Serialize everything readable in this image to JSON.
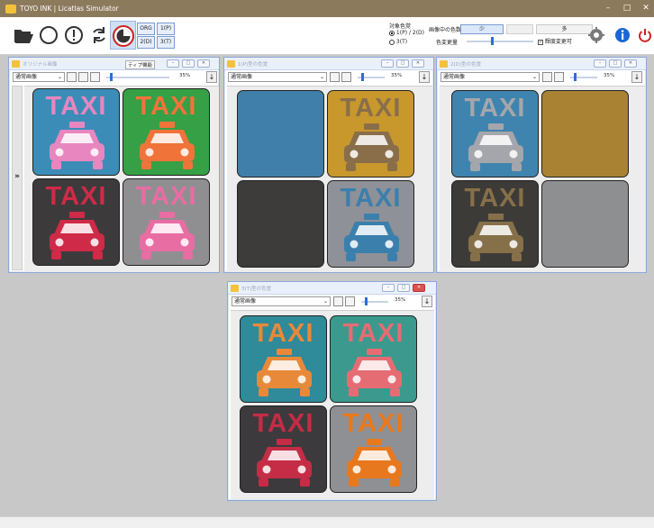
{
  "app": {
    "title": "TOYO INK | Licatlas Simulator"
  },
  "window_controls": {
    "minimize": "–",
    "maximize": "□",
    "close": "✕"
  },
  "toolbar": {
    "orig_label": "ORG",
    "p1_label": "1(P)",
    "d2_label": "2(D)",
    "t3_label": "3(T)",
    "target_label": "対象色覚",
    "radio1_label": "1(P) / 2(D)",
    "radio2_label": "3(T)",
    "display_colors_label": "画像中の色数",
    "few_label": "少",
    "many_label": "多",
    "change_label": "色変更量",
    "brightness_label": "輝度変更可",
    "icons": [
      "open-folder-icon",
      "circle-icon",
      "exclamation-icon",
      "refresh-icon",
      "color-simulate-icon",
      "settings-icon",
      "info-icon",
      "power-icon"
    ],
    "accent": "#d12020"
  },
  "panels": {
    "original": {
      "title": "オリジナル画像",
      "mode": "通常画像",
      "zoom": "35%",
      "tip_label": "ティプ機能",
      "expand_label": "»"
    },
    "p": {
      "title": "1(P)型の色覚",
      "mode": "通常画像",
      "zoom": "35%"
    },
    "d": {
      "title": "2(D)型の色覚",
      "mode": "通常画像",
      "zoom": "35%"
    },
    "t": {
      "title": "3(T)型の色覚",
      "mode": "通常画像",
      "zoom": "35%"
    }
  },
  "taxi_text": "TAXI",
  "tiles": {
    "original": [
      {
        "bg": "#3b8db8",
        "fg": "#e886bf",
        "show": true
      },
      {
        "bg": "#35a045",
        "fg": "#f0733a",
        "show": true
      },
      {
        "bg": "#3d3a3c",
        "fg": "#cf2a47",
        "show": true
      },
      {
        "bg": "#8f8f91",
        "fg": "#e86da3",
        "show": true
      }
    ],
    "p": [
      {
        "bg": "#3f7fa9",
        "fg": "#3f7fa9",
        "show": false
      },
      {
        "bg": "#c8982d",
        "fg": "#8a6e4a",
        "show": true
      },
      {
        "bg": "#3d3c3a",
        "fg": "#3d3c3a",
        "show": false
      },
      {
        "bg": "#8e9197",
        "fg": "#3b7fad",
        "show": true
      }
    ],
    "d": [
      {
        "bg": "#3f84ae",
        "fg": "#a5a6ac",
        "show": true
      },
      {
        "bg": "#a98233",
        "fg": "#a98233",
        "show": false
      },
      {
        "bg": "#3d3b37",
        "fg": "#86704a",
        "show": true
      },
      {
        "bg": "#8e8f91",
        "fg": "#8e8f91",
        "show": false
      }
    ],
    "t": [
      {
        "bg": "#2f8a9a",
        "fg": "#e8893a",
        "show": true
      },
      {
        "bg": "#3b9a8d",
        "fg": "#e66c74",
        "show": true
      },
      {
        "bg": "#3d3a3d",
        "fg": "#c52c45",
        "show": true
      },
      {
        "bg": "#8f9093",
        "fg": "#e8781d",
        "show": true
      }
    ]
  }
}
